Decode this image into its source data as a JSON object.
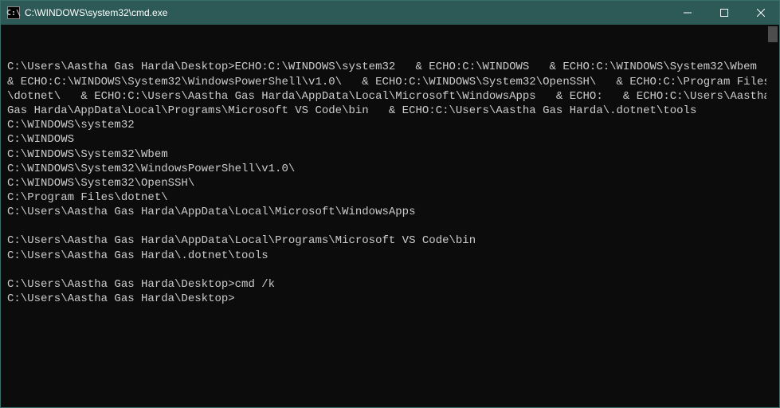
{
  "titlebar": {
    "icon_label": "C:\\",
    "title": "C:\\WINDOWS\\system32\\cmd.exe"
  },
  "terminal": {
    "lines": [
      "C:\\Users\\Aastha Gas Harda\\Desktop>ECHO:C:\\WINDOWS\\system32   & ECHO:C:\\WINDOWS   & ECHO:C:\\WINDOWS\\System32\\Wbem   & ECHO:C:\\WINDOWS\\System32\\WindowsPowerShell\\v1.0\\   & ECHO:C:\\WINDOWS\\System32\\OpenSSH\\   & ECHO:C:\\Program Files\\dotnet\\   & ECHO:C:\\Users\\Aastha Gas Harda\\AppData\\Local\\Microsoft\\WindowsApps   & ECHO:   & ECHO:C:\\Users\\Aastha Gas Harda\\AppData\\Local\\Programs\\Microsoft VS Code\\bin   & ECHO:C:\\Users\\Aastha Gas Harda\\.dotnet\\tools",
      "C:\\WINDOWS\\system32",
      "C:\\WINDOWS",
      "C:\\WINDOWS\\System32\\Wbem",
      "C:\\WINDOWS\\System32\\WindowsPowerShell\\v1.0\\",
      "C:\\WINDOWS\\System32\\OpenSSH\\",
      "C:\\Program Files\\dotnet\\",
      "C:\\Users\\Aastha Gas Harda\\AppData\\Local\\Microsoft\\WindowsApps",
      "",
      "C:\\Users\\Aastha Gas Harda\\AppData\\Local\\Programs\\Microsoft VS Code\\bin",
      "C:\\Users\\Aastha Gas Harda\\.dotnet\\tools",
      "",
      "C:\\Users\\Aastha Gas Harda\\Desktop>cmd /k",
      "C:\\Users\\Aastha Gas Harda\\Desktop>"
    ]
  }
}
